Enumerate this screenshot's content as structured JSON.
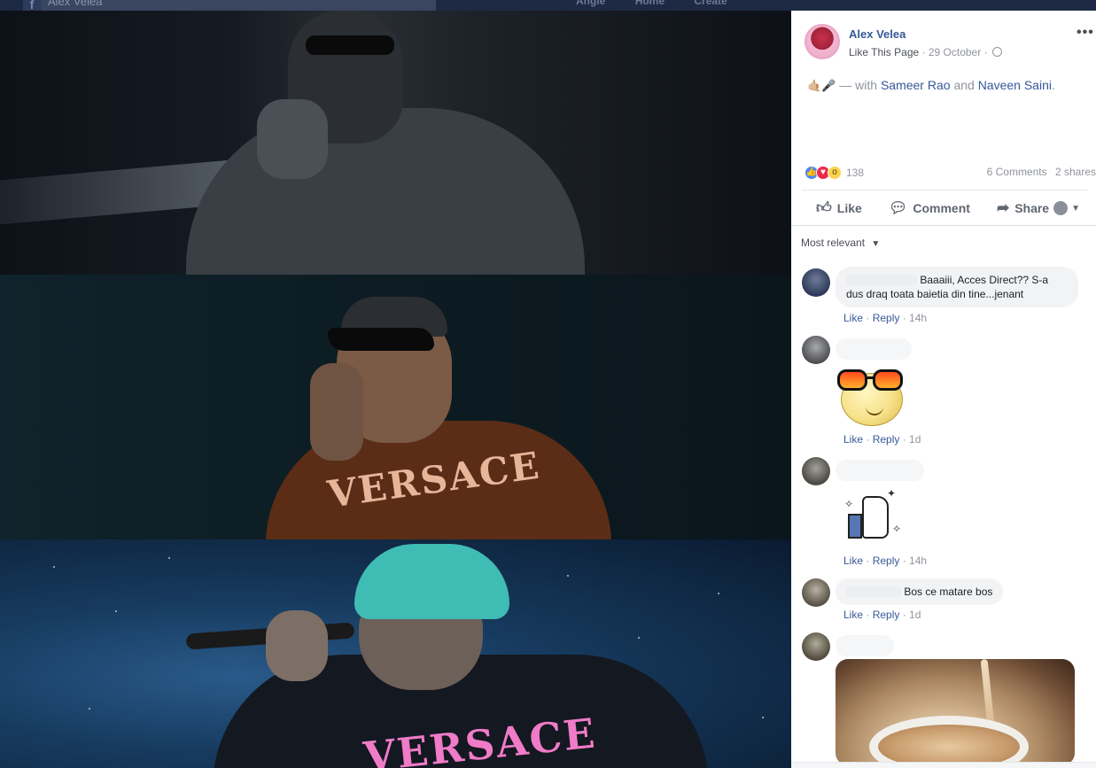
{
  "nav": {
    "page_name": "Alex Velea",
    "links": [
      "Angie",
      "Home",
      "Create"
    ]
  },
  "post": {
    "author": "Alex Velea",
    "like_page": "Like This Page",
    "date": "29 October",
    "more_label": "•••",
    "caption_emoji": "🤙🏼🎤",
    "caption_with": "— with",
    "tag_1": "Sameer Rao",
    "caption_and": "and",
    "tag_2": "Naveen Saini",
    "caption_end": ".",
    "reaction_count": "138",
    "comments_count": "6 Comments",
    "shares_count": "2 shares",
    "actions": {
      "like": "Like",
      "comment": "Comment",
      "share": "Share"
    },
    "sort_label": "Most relevant"
  },
  "comments": [
    {
      "text": "Baaaiii, Acces Direct?? S-a dus draq toata baietia din tine...jenant",
      "like": "Like",
      "reply": "Reply",
      "time": "14h"
    },
    {
      "sticker": "sunglasses-sticker",
      "like": "Like",
      "reply": "Reply",
      "time": "1d"
    },
    {
      "sticker": "thumbs-up-sticker",
      "like": "Like",
      "reply": "Reply",
      "time": "14h"
    },
    {
      "text": "Bos ce matare bos",
      "like": "Like",
      "reply": "Reply",
      "time": "1d"
    },
    {
      "image": "coffee-cup-image"
    }
  ],
  "photo_prints": {
    "panel_2": "VERSACE",
    "panel_3": "VERSACE"
  },
  "colors": {
    "link": "#365899",
    "meta": "#90949c",
    "like_reaction": "#4a88f6",
    "love_reaction": "#f0284a",
    "wow_reaction": "#fcd34d"
  }
}
